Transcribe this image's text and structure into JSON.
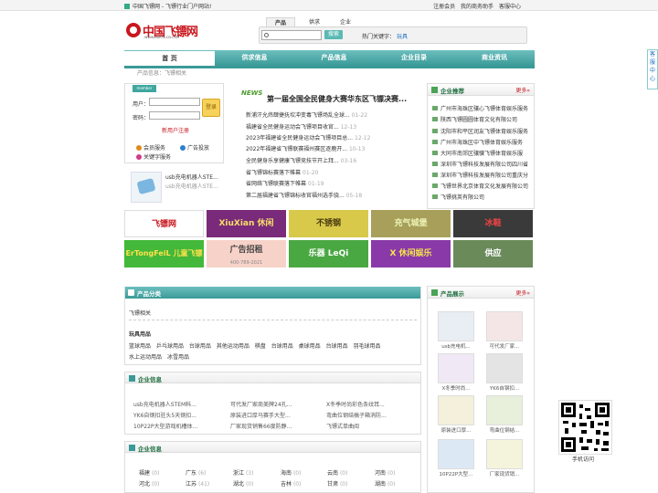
{
  "topbar": {
    "home_text": "中国飞镖网 - 飞镖行业门户网站!",
    "links": [
      "注册会员",
      "我的商务助手",
      "客服中心"
    ]
  },
  "logo": {
    "text": "中国飞镖网",
    "sub": "WWW.DARTS-CN.COM"
  },
  "search": {
    "tabs": [
      "产品",
      "供求",
      "企业"
    ],
    "button": "搜索",
    "hot_label": "热门关键字：",
    "hot_keyword": "玩具"
  },
  "nav": {
    "items": [
      "首 页",
      "供求信息",
      "产品信息",
      "企业目录",
      "商业资讯"
    ]
  },
  "breadcrumb": "产品信息：飞镖相关",
  "login": {
    "tag": "member",
    "user_label": "用户：",
    "pass_label": "密码：",
    "login_button": "登录",
    "register": "新用户注册",
    "services": [
      {
        "label": "会员服务",
        "color": "#e08a1a"
      },
      {
        "label": "广告投放",
        "color": "#2d7fd0"
      },
      {
        "label": "关键字服务",
        "color": "#d03a8a"
      }
    ]
  },
  "robot": {
    "title": "usb充电机器人STE...",
    "subtitle": "usb充电机器人STE..."
  },
  "news": {
    "logo": "NEWS",
    "headline": "第一届全国全民健身大赛华东区飞镖决赛...",
    "items": [
      {
        "title": "新浦汗允炜肆捷抚坎冲变毒飞镖场乱全球...",
        "date": "01-22"
      },
      {
        "title": "福建省全民健身运动会飞镖项目收官...",
        "date": "12-13"
      },
      {
        "title": "2023年福建省全民健身运动会飞镖项目总...",
        "date": "12-12"
      },
      {
        "title": "2022年福建省飞镖联赛福州赛区逐鹿开...",
        "date": "10-13"
      },
      {
        "title": "全民健身乐享健康飞镖竞技节开上拜...",
        "date": "03-16"
      },
      {
        "title": "省飞镖锦标赛落下帷幕",
        "date": "01-20"
      },
      {
        "title": "省网络飞镖联赛落下帷幕",
        "date": "01-19"
      },
      {
        "title": "第二届福建省飞镖锦标收官福州选手骁...",
        "date": "05-18"
      }
    ]
  },
  "corp": {
    "title": "企业推荐",
    "more": "更多»",
    "items": [
      "广州市海珠区骧心飞镖体育娱乐服务",
      "陕西飞镖圆圆体育文化有限公司",
      "沈阳市和平区润友飞镖体育娱乐服务",
      "广州市海珠区中飞镖体育娱乐服务",
      "大同市南郊区骧骥飞镖体育娱乐服",
      "深圳市飞镖科技发展有限公司四川省",
      "深圳市飞镖科技发展有限公司重庆分",
      "飞镖世界北京体育文化发展有限公司",
      "飞镖挑英有限公司"
    ]
  },
  "ads": [
    {
      "text": "飞镖网",
      "bg": "#ffffff",
      "fg": "#c8171e"
    },
    {
      "text": "XiuXian 休闲",
      "bg": "#7a2a7a",
      "fg": "#f5e06a"
    },
    {
      "text": "不锈钢",
      "bg": "#d8c94a",
      "fg": "#4a3a10"
    },
    {
      "text": "充气城堡",
      "bg": "#a8a05a",
      "fg": "#eef4b8"
    },
    {
      "text": "冰鞋",
      "bg": "#3a3a3a",
      "fg": "#e44"
    },
    {
      "text": "ErTongFeiL 儿童飞镖",
      "bg": "#43b83a",
      "fg": "#ffe24a"
    },
    {
      "text": "广告招租",
      "bg": "#f7d2c8",
      "fg": "#444"
    },
    {
      "text": "乐器 LeQi",
      "bg": "#4aa842",
      "fg": "#fff"
    },
    {
      "text": "X 休闲娱乐",
      "bg": "#8a3aa8",
      "fg": "#f5e64a"
    },
    {
      "text": "供应",
      "bg": "#6a8a5a",
      "fg": "#fff"
    }
  ],
  "ad_phone": "400-789-2021",
  "product_cat": {
    "title": "产品分类",
    "main": "飞镖相关",
    "group_title": "玩具用品",
    "line1": [
      "篮球用品",
      "乒乓球用品",
      "台球用品",
      "其他运动用品",
      "棋盘",
      "台球用品",
      "桌球用品",
      "台球用品",
      "羽毛球用品"
    ],
    "line2": [
      "水上运动用品",
      "冰雪用品"
    ]
  },
  "enterprise_info1": {
    "title": "企业信息",
    "col1": [
      "usb充电机器人STEM科...",
      "YK6自钢扣驻头5天钢扣...",
      "10P22P大型游戏机槽体..."
    ],
    "col2": [
      "可代发厂家商美牌24孔...",
      "原装进口厚马赛手大型...",
      "厂家现货销售66度防静..."
    ],
    "col3": [
      "X冬季时尚彩色条纹耳...",
      "弯曲位钢结搞子箱消防...",
      "飞镖式单曲阅"
    ]
  },
  "enterprise_info2": {
    "title": "企业信息",
    "provinces": [
      {
        "name": "福建",
        "count": "(0)"
      },
      {
        "name": "广东",
        "count": "(6)"
      },
      {
        "name": "浙江",
        "count": "(3)"
      },
      {
        "name": "海南",
        "count": "(0)"
      },
      {
        "name": "云南",
        "count": "(0)"
      },
      {
        "name": "河南",
        "count": "(0)"
      },
      {
        "name": "河北",
        "count": "(0)"
      },
      {
        "name": "江苏",
        "count": "(41)"
      },
      {
        "name": "湖北",
        "count": "(0)"
      },
      {
        "name": "吉林",
        "count": "(0)"
      },
      {
        "name": "甘肃",
        "count": "(0)"
      },
      {
        "name": "湖南",
        "count": "(0)"
      }
    ]
  },
  "product_show": {
    "title": "产品展示",
    "more": "更多»",
    "items": [
      "usb充电机...",
      "可代发厂家...",
      "X冬季时尚...",
      "YK6自钢扣...",
      "原装进口厚...",
      "弯曲位钢结...",
      "10P22P大型...",
      "厂家现货销..."
    ]
  },
  "service_float": "客服中心",
  "qr_caption": "手机访问"
}
